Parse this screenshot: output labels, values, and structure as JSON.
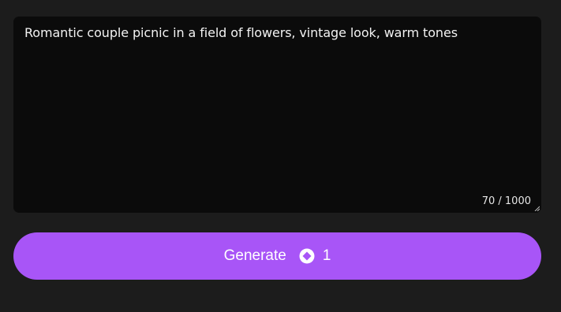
{
  "prompt": {
    "value": "Romantic couple picnic in a field of flowers, vintage look, warm tones",
    "counter": "70 / 1000"
  },
  "generate_button": {
    "label": "Generate",
    "credit_icon": "diamond-coin-icon",
    "credits": "1"
  },
  "colors": {
    "background": "#1c1c1c",
    "textarea": "#0b0b0b",
    "accent": "#a855f7"
  }
}
